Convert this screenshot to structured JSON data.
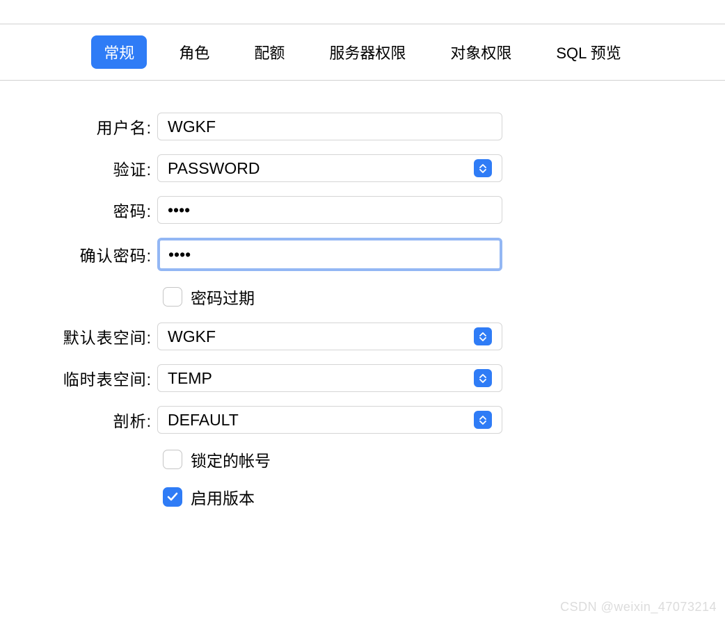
{
  "tabs": {
    "general": "常规",
    "roles": "角色",
    "quota": "配额",
    "server_privs": "服务器权限",
    "object_privs": "对象权限",
    "sql_preview": "SQL 预览"
  },
  "labels": {
    "username": "用户名:",
    "auth": "验证:",
    "password": "密码:",
    "confirm_password": "确认密码:",
    "password_expired": "密码过期",
    "default_tablespace": "默认表空间:",
    "temp_tablespace": "临时表空间:",
    "profile": "剖析:",
    "locked_account": "锁定的帐号",
    "enable_versions": "启用版本"
  },
  "values": {
    "username": "WGKF",
    "auth": "PASSWORD",
    "password": "••••",
    "confirm_password": "••••",
    "default_tablespace": "WGKF",
    "temp_tablespace": "TEMP",
    "profile": "DEFAULT"
  },
  "watermark": "CSDN @weixin_47073214"
}
